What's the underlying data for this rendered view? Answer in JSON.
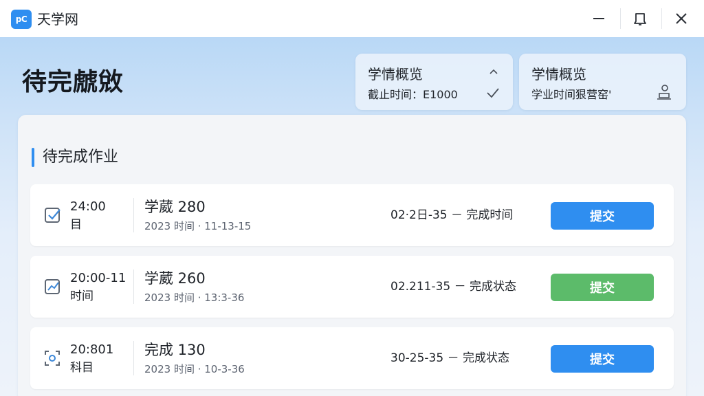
{
  "app": {
    "logo_text": "pC",
    "title": "天学网"
  },
  "window_controls": [
    "minimize-icon",
    "bell-icon",
    "close-icon"
  ],
  "header": {
    "title": "待完虤敓",
    "cards": [
      {
        "title": "学情概览",
        "subtitle": "截止时间：E1000",
        "icons": [
          "chevron-up-icon",
          "check-icon"
        ]
      },
      {
        "title": "学情概览",
        "subtitle": "学业时间狠营窑'",
        "icons": [
          "person-desk-icon"
        ]
      }
    ]
  },
  "section": {
    "title": "待完成作业"
  },
  "tasks": [
    {
      "time": "24:00",
      "time_label": "目",
      "name": "学葳 280",
      "date": "2023 时间 · 11-13-15",
      "status": "02·2日-35 － 完成时间",
      "button": "提交",
      "button_color": "#2f8ef0",
      "icon": "checkbox-icon"
    },
    {
      "time": "20:00-11",
      "time_label": "时间",
      "name": "学葳 260",
      "date": "2023 时间 · 13:3-36",
      "status": "02.211-35 － 完成状态",
      "button": "提交",
      "button_color": "#5cbb6a",
      "icon": "edit-chart-icon"
    },
    {
      "time": "20:801",
      "time_label": "科目",
      "name": "完成 130",
      "date": "2023 时间 · 10-3-36",
      "status": "30-25-35 － 完成状态",
      "button": "提交",
      "button_color": "#2f8ef0",
      "icon": "scan-frame-icon"
    }
  ],
  "colors": {
    "accent": "#2f8ef0",
    "success": "#5cbb6a"
  }
}
